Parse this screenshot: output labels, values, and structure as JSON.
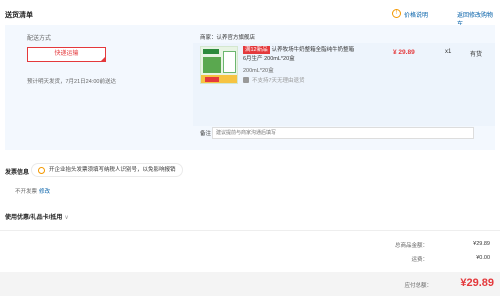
{
  "header": {
    "title": "送货清单",
    "price_note": "价格说明",
    "back_to_cart": "返回修改购物车"
  },
  "shipping": {
    "label": "配送方式",
    "method": "快递运输",
    "delivery_time": "预计明天发货，7月21日24:00前送达"
  },
  "goods": {
    "seller": "商家：认养官方旗舰店",
    "tag": "满12新品",
    "name": "认养牧场牛奶整箱全脂纯牛奶整箱",
    "name2": "6月生产 200mL*20盒",
    "spec": "200mL*20盒",
    "no_return": "不支持7天无理由退货",
    "price": "¥ 29.89",
    "qty": "x1",
    "stock": "有货",
    "remark_label": "备注：",
    "remark_placeholder": "建议提前与商家沟通后填写"
  },
  "invoice": {
    "label": "发票信息",
    "tip": "开企业抬头发票须填写纳税人识别号，以免影响报销",
    "info": "不开发票",
    "edit": "修改"
  },
  "coupon": {
    "label": "使用优惠/礼品卡/抵用",
    "chevron": "∨"
  },
  "summary": {
    "goods_total_label": "总商品金额：",
    "goods_total": "¥29.89",
    "shipping_label": "运费：",
    "shipping": "¥0.00",
    "payable_label": "应付总额：",
    "payable": "¥29.89"
  },
  "colors": {
    "accent_red": "#e4393c",
    "link_blue": "#005ea7",
    "box_bg": "#f3f8fe"
  }
}
